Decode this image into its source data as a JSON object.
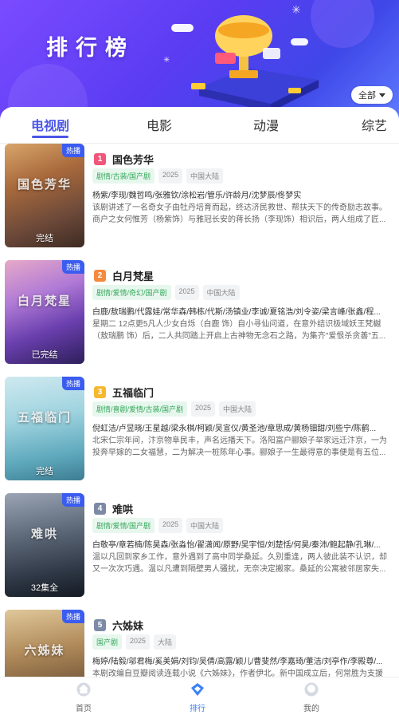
{
  "banner": {
    "title": "排行榜",
    "filter_label": "全部"
  },
  "tabs": [
    "电视剧",
    "电影",
    "动漫",
    "综艺"
  ],
  "hot_label": "热播",
  "items": [
    {
      "rank": "1",
      "rank_color": "#f0557a",
      "title": "国色芳华",
      "tags": [
        "剧情/古装/国产剧",
        "2025",
        "中国大陆"
      ],
      "cast": "杨紫/李现/魏哲鸣/张雅钦/涂松岩/管乐/许龄月/沈梦辰/佟梦实",
      "desc": "该剧讲述了一名奇女子由牡丹培育而起，终达济民救世、帮扶天下的传奇励志故事。商户之女何惟芳（杨紫饰）与雅冠长安的蒋长扬（李现饰）相识后，两人组成了匠...",
      "poster_caption": "完结",
      "poster_bg": "linear-gradient(160deg,#d9a56a 0%,#a86a3c 35%,#6e4a3a 70%,#3d2a22 100%)",
      "poster_text": "国色芳华"
    },
    {
      "rank": "2",
      "rank_color": "#f58a3c",
      "title": "白月梵星",
      "tags": [
        "剧情/爱情/奇幻/国产剧",
        "2025",
        "中国大陆"
      ],
      "cast": "白鹿/敖瑞鹏/代露娃/常华森/韩栋/代斯/汤镇业/李诚/夏铭浩/刘令姿/梁言峰/张鑫/程...",
      "desc": "星期二 12点更5凡人少女白烁（白鹿 饰）自小寻仙问道，在意外结识极域妖王梵樾（敖瑞鹏 饰）后，二人共同踏上开启上古神物无念石之路，为集齐\"爱恨杀贪善\"五...",
      "poster_caption": "已完结",
      "poster_bg": "linear-gradient(160deg,#e7a9c8 0%,#b07ad6 35%,#6a3fae 65%,#2d1f5a 100%)",
      "poster_text": "白月梵星"
    },
    {
      "rank": "3",
      "rank_color": "#f5b82e",
      "title": "五福临门",
      "tags": [
        "剧情/喜剧/爱情/古装/国产剧",
        "2025",
        "中国大陆"
      ],
      "cast": "倪虹洁/卢昱晓/王星越/梁永棋/柯颖/吴宣仪/黄圣池/章思成/黄杨钿甜/刘些宁/陈鹤...",
      "desc": "北宋仁宗年间，汴京物阜民丰，声名远播天下。洛阳富户郦娘子举家远迁汴京，一为投奔早嫁的二女福慧，二为解决一桩陈年心事。郦娘子一生最得意的事便是有五位...",
      "poster_caption": "完结",
      "poster_bg": "linear-gradient(170deg,#cfe9f0 0%,#9fd3df 40%,#5fa9bd 75%,#3d7d92 100%)",
      "poster_text": "五福临门"
    },
    {
      "rank": "4",
      "rank_color": "#7d8aa6",
      "title": "难哄",
      "tags": [
        "剧情/爱情/国产剧",
        "2025",
        "中国大陆"
      ],
      "cast": "白敬亭/章若楠/陈昊森/张淼怡/翟潇闻/原野/吴宇恒/刘楚恬/何昊/秦沛/鲍起静/孔琳/...",
      "desc": "温以凡回到家乡工作，意外遇到了高中同学桑延。久别重逢，两人彼此装不认识，却又一次次巧遇。温以凡遭到隔壁男人骚扰，无奈决定搬家。桑延的公寓被邻居家失...",
      "poster_caption": "32集全",
      "poster_bg": "linear-gradient(170deg,#9aa4b4 0%,#5d6878 40%,#2f3846 75%,#141a22 100%)",
      "poster_text": "难哄"
    },
    {
      "rank": "5",
      "rank_color": "#7d8aa6",
      "title": "六姊妹",
      "tags": [
        "国产剧",
        "2025",
        "大陆"
      ],
      "cast": "梅婷/陆毅/邬君梅/奚美娟/刘钧/吴倩/高露/颖儿/曹斐然/李嘉琦/董洁/刘亭作/李殿尊/...",
      "desc": "本剧改编自豆瓣阅读连载小说《六姊妹》，作者伊北。新中国成立后，何常胜为支援",
      "poster_caption": "",
      "poster_bg": "linear-gradient(170deg,#e0c89a 0%,#b08a5a 40%,#6e5236 80%,#3d2c1e 100%)",
      "poster_text": "六姊妹"
    }
  ],
  "nav": [
    {
      "label": "首页",
      "icon": "home-icon"
    },
    {
      "label": "排行",
      "icon": "ranking-icon"
    },
    {
      "label": "我的",
      "icon": "profile-icon"
    }
  ],
  "colors": {
    "accent": "#4a55e6",
    "nav_active": "#3b82f6",
    "genre_tag": "#34a85a"
  }
}
